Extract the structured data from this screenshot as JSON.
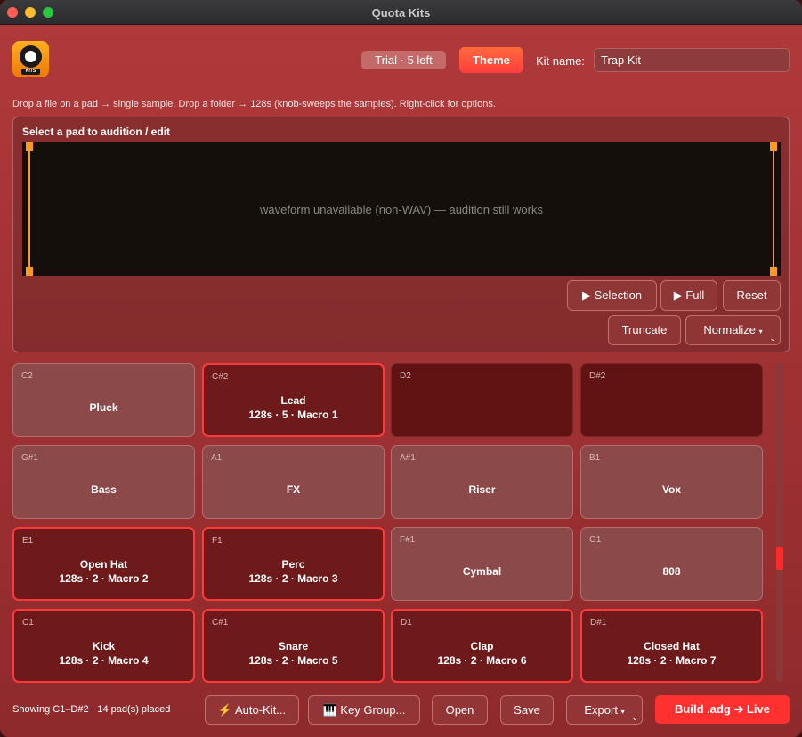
{
  "window": {
    "title": "Quota Kits"
  },
  "header": {
    "logo_text": "KITS",
    "trial_label": "Trial · 5 left",
    "theme_label": "Theme",
    "kit_name_label": "Kit name:",
    "kit_name_value": "Trap Kit"
  },
  "hint": "Drop a file on a pad → single sample.   Drop a folder → 128s (knob-sweeps the samples).   Right-click for options.",
  "editor": {
    "title": "Select a pad to audition / edit",
    "waveform_message": "waveform unavailable (non-WAV) — audition still works",
    "buttons": {
      "selection": "▶ Selection",
      "full": "▶ Full",
      "reset": "Reset",
      "truncate": "Truncate",
      "normalize": "Normalize",
      "normalize_caret": "▾"
    }
  },
  "pads": [
    {
      "note": "C2",
      "name": "Pluck",
      "info": "",
      "state": "filled"
    },
    {
      "note": "C#2",
      "name": "Lead",
      "info": "128s · 5 · Macro 1",
      "state": "macro"
    },
    {
      "note": "D2",
      "name": "",
      "info": "",
      "state": "empty"
    },
    {
      "note": "D#2",
      "name": "",
      "info": "",
      "state": "empty"
    },
    {
      "note": "G#1",
      "name": "Bass",
      "info": "",
      "state": "filled"
    },
    {
      "note": "A1",
      "name": "FX",
      "info": "",
      "state": "filled"
    },
    {
      "note": "A#1",
      "name": "Riser",
      "info": "",
      "state": "filled"
    },
    {
      "note": "B1",
      "name": "Vox",
      "info": "",
      "state": "filled"
    },
    {
      "note": "E1",
      "name": "Open Hat",
      "info": "128s · 2 · Macro 2",
      "state": "macro"
    },
    {
      "note": "F1",
      "name": "Perc",
      "info": "128s · 2 · Macro 3",
      "state": "macro"
    },
    {
      "note": "F#1",
      "name": "Cymbal",
      "info": "",
      "state": "filled"
    },
    {
      "note": "G1",
      "name": "808",
      "info": "",
      "state": "filled"
    },
    {
      "note": "C1",
      "name": "Kick",
      "info": "128s · 2 · Macro 4",
      "state": "macro"
    },
    {
      "note": "C#1",
      "name": "Snare",
      "info": "128s · 2 · Macro 5",
      "state": "macro"
    },
    {
      "note": "D1",
      "name": "Clap",
      "info": "128s · 2 · Macro 6",
      "state": "macro"
    },
    {
      "note": "D#1",
      "name": "Closed Hat",
      "info": "128s · 2 · Macro 7",
      "state": "macro"
    }
  ],
  "footer": {
    "status": "Showing C1–D#2   ·   14 pad(s) placed",
    "auto_kit": "⚡ Auto-Kit...",
    "key_group": "🎹 Key Group...",
    "open": "Open",
    "save": "Save",
    "export": "Export",
    "export_caret": "▾",
    "build": "Build .adg ➔ Live"
  },
  "scroll": {
    "position": 0.62
  }
}
